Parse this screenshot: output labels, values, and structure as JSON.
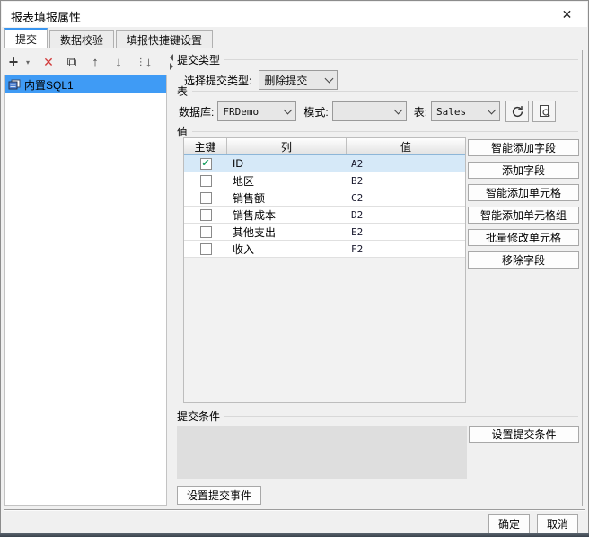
{
  "window": {
    "title": "报表填报属性",
    "close_glyph": "✕"
  },
  "tabs": [
    {
      "label": "提交",
      "active": true
    },
    {
      "label": "数据校验",
      "active": false
    },
    {
      "label": "填报快捷键设置",
      "active": false
    }
  ],
  "left_panel": {
    "toolbar": {
      "add": "+",
      "add_caret": "▾",
      "delete": "✕",
      "copy": "⧉",
      "up": "↑",
      "down": "↓",
      "sort_dots": "⋮",
      "sort_arrow": "↓"
    },
    "items": [
      {
        "label": "内置SQL1",
        "selected": true
      }
    ]
  },
  "submit_type": {
    "group_title": "提交类型",
    "label": "选择提交类型:",
    "value": "删除提交"
  },
  "table_section": {
    "group_title": "表",
    "db_label": "数据库:",
    "db_value": "FRDemo",
    "schema_label": "模式:",
    "schema_value": "",
    "table_label": "表:",
    "table_value": "Sales"
  },
  "value_section": {
    "group_title": "值",
    "columns": [
      "主键",
      "列",
      "值"
    ],
    "rows": [
      {
        "check": "✔",
        "checked": true,
        "col": "ID",
        "val": "A2"
      },
      {
        "check": "",
        "checked": false,
        "col": "地区",
        "val": "B2"
      },
      {
        "check": "",
        "checked": false,
        "col": "销售额",
        "val": "C2"
      },
      {
        "check": "",
        "checked": false,
        "col": "销售成本",
        "val": "D2"
      },
      {
        "check": "",
        "checked": false,
        "col": "其他支出",
        "val": "E2"
      },
      {
        "check": "",
        "checked": false,
        "col": "收入",
        "val": "F2"
      }
    ]
  },
  "action_buttons": [
    "智能添加字段",
    "添加字段",
    "智能添加单元格",
    "智能添加单元格组",
    "批量修改单元格",
    "移除字段"
  ],
  "condition_section": {
    "group_title": "提交条件",
    "set_button": "设置提交条件"
  },
  "event_button": "设置提交事件",
  "footer": {
    "ok": "确定",
    "cancel": "取消"
  },
  "colors": {
    "accent_blue": "#3f9bf5",
    "selected_row": "#d6e9f8",
    "check_green": "#21a366",
    "delete_red": "#d23a3a",
    "dialog_bg": "#f0f0f0"
  }
}
